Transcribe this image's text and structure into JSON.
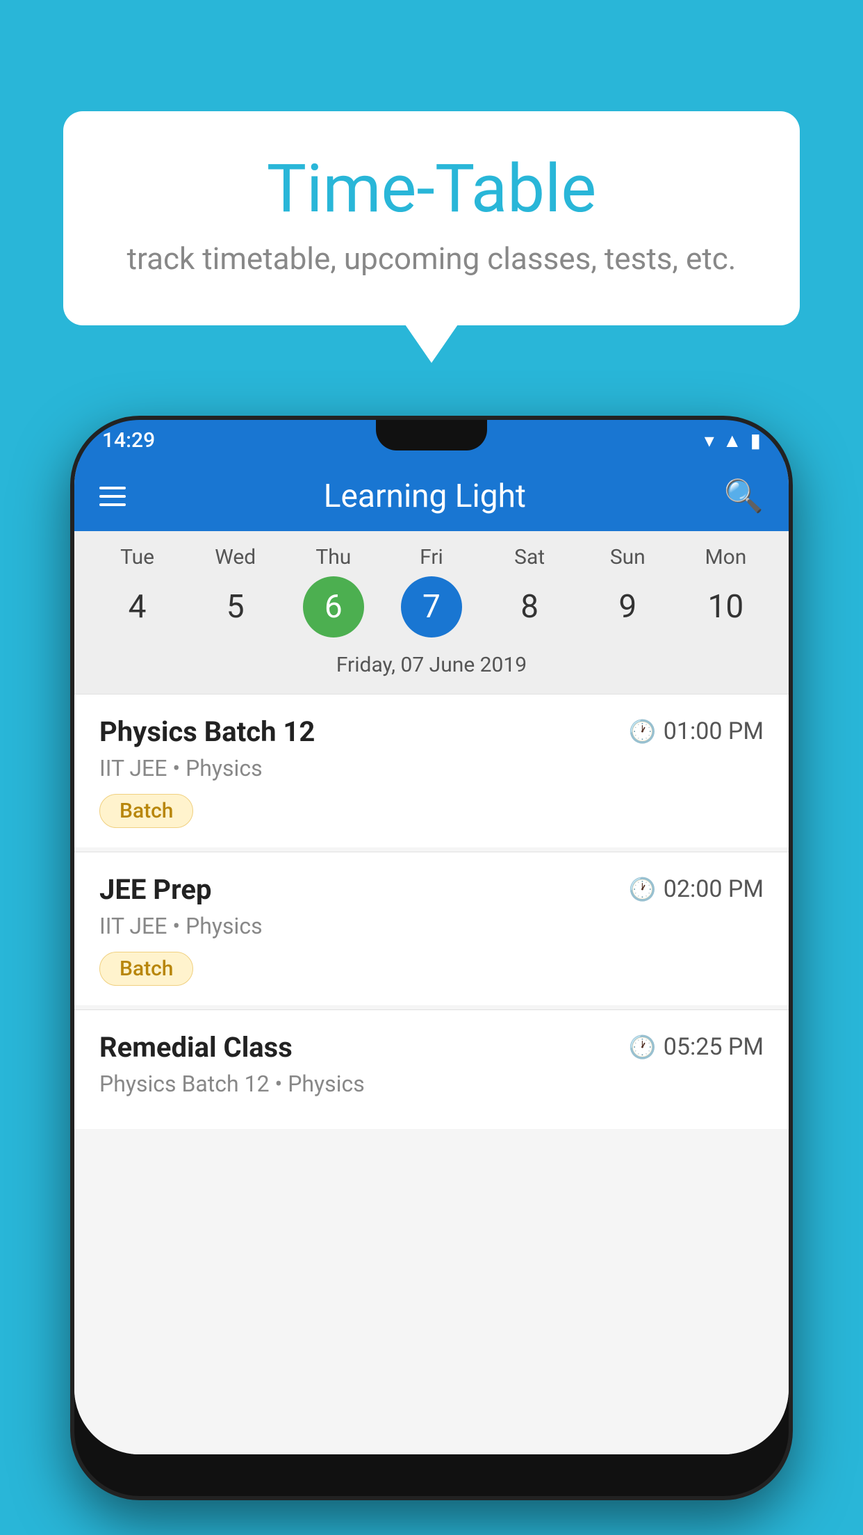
{
  "background": {
    "color": "#29b6d8"
  },
  "speech_bubble": {
    "title": "Time-Table",
    "subtitle": "track timetable, upcoming classes, tests, etc."
  },
  "phone": {
    "status_bar": {
      "time": "14:29"
    },
    "toolbar": {
      "title": "Learning Light",
      "menu_icon": "☰",
      "search_icon": "🔍"
    },
    "calendar": {
      "days": [
        {
          "label": "Tue",
          "num": "4",
          "state": "normal"
        },
        {
          "label": "Wed",
          "num": "5",
          "state": "normal"
        },
        {
          "label": "Thu",
          "num": "6",
          "state": "today"
        },
        {
          "label": "Fri",
          "num": "7",
          "state": "selected"
        },
        {
          "label": "Sat",
          "num": "8",
          "state": "normal"
        },
        {
          "label": "Sun",
          "num": "9",
          "state": "normal"
        },
        {
          "label": "Mon",
          "num": "10",
          "state": "normal"
        }
      ],
      "selected_date_label": "Friday, 07 June 2019"
    },
    "events": [
      {
        "title": "Physics Batch 12",
        "time": "01:00 PM",
        "meta": "IIT JEE • Physics",
        "tag": "Batch"
      },
      {
        "title": "JEE Prep",
        "time": "02:00 PM",
        "meta": "IIT JEE • Physics",
        "tag": "Batch"
      },
      {
        "title": "Remedial Class",
        "time": "05:25 PM",
        "meta": "Physics Batch 12 • Physics",
        "tag": ""
      }
    ]
  }
}
